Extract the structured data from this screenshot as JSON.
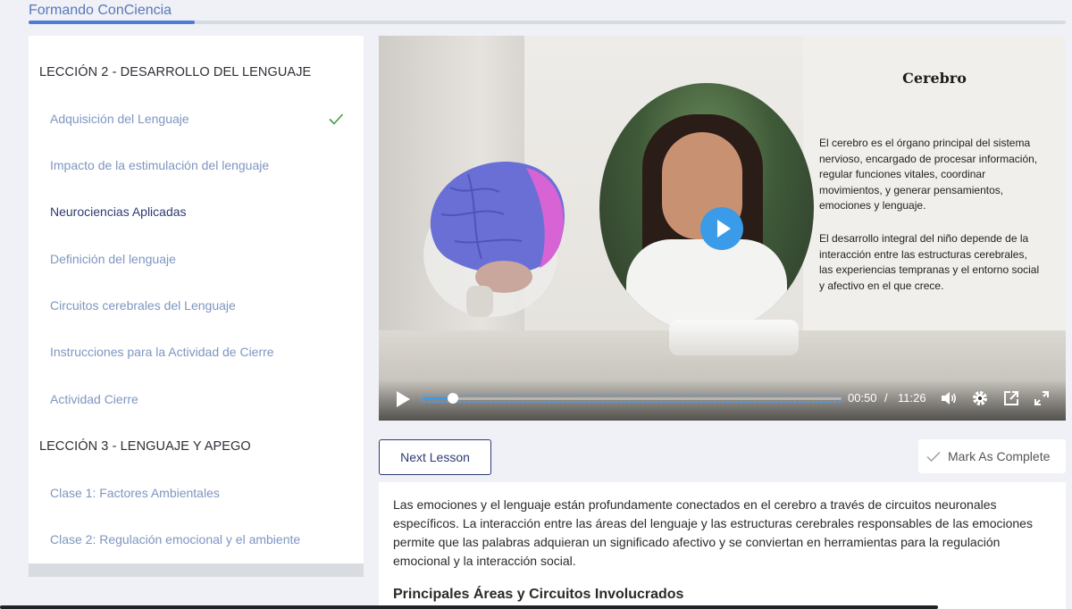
{
  "header": {
    "brand": "Formando ConCiencia",
    "course_progress": 0.16
  },
  "sidebar": {
    "sections": [
      {
        "title": "LECCIÓN 2 - DESARROLLO DEL LENGUAJE"
      },
      {
        "title": "LECCIÓN 3 - LENGUAJE Y APEGO"
      }
    ],
    "items": [
      {
        "label": "Adquisición del Lenguaje",
        "completed": true
      },
      {
        "label": "Impacto de la estimulación del lenguaje"
      },
      {
        "label": "Neurociencias Aplicadas",
        "active": true
      },
      {
        "label": "Definición del lenguaje"
      },
      {
        "label": "Circuitos cerebrales del Lenguaje"
      },
      {
        "label": "Instrucciones para la Actividad de Cierre"
      },
      {
        "label": "Actividad Cierre"
      },
      {
        "label": "Clase 1: Factores Ambientales"
      },
      {
        "label": "Clase 2: Regulación emocional y el ambiente"
      }
    ]
  },
  "video": {
    "slide_title": "Cerebro",
    "slide_paragraph_1": "El cerebro es el órgano principal del sistema nervioso, encargado de procesar información, regular funciones vitales, coordinar movimientos, y generar pensamientos, emociones y lenguaje.",
    "slide_paragraph_2": "El desarrollo integral del niño depende de la interacción entre las estructuras cerebrales, las experiencias tempranas y el entorno social y afectivo en el que crece.",
    "current_time": "00:50",
    "separator": "/",
    "duration": "11:26",
    "played_fraction": 0.073
  },
  "actions": {
    "next_label": "Next Lesson",
    "complete_label": "Mark As Complete"
  },
  "content": {
    "paragraph": "Las emociones y el lenguaje están profundamente conectados en el cerebro a través de circuitos neuronales específicos. La interacción entre las áreas del lenguaje y las estructuras cerebrales responsables de las emociones permite que las palabras adquieran un significado afectivo y se conviertan en herramientas para la regulación emocional y la interacción social.",
    "heading": "Principales Áreas y Circuitos Involucrados"
  },
  "colors": {
    "accent": "#4f7bd8",
    "link": "#7e96c0",
    "active": "#2d3b74",
    "check": "#4a9a4a"
  }
}
